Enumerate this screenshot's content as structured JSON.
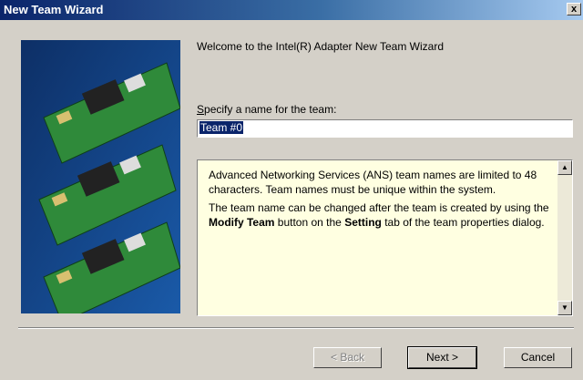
{
  "window": {
    "title": "New Team Wizard",
    "close_label": "x"
  },
  "wizard": {
    "welcome": "Welcome to the Intel(R) Adapter New Team Wizard",
    "name_label_accel": "S",
    "name_label_rest": "pecify a name for the team:",
    "team_name_value": "Team #0",
    "info_p1": "Advanced Networking Services (ANS) team names are limited to 48 characters. Team names must be unique within the system.",
    "info_p2_a": "The team name can be changed after the team is created by using the ",
    "info_p2_b": "Modify Team",
    "info_p2_c": " button on the ",
    "info_p2_d": "Setting",
    "info_p2_e": " tab of the team properties dialog."
  },
  "buttons": {
    "back": "< Back",
    "next": "Next >",
    "cancel": "Cancel"
  },
  "icons": {
    "scroll_up": "▲",
    "scroll_down": "▼"
  }
}
